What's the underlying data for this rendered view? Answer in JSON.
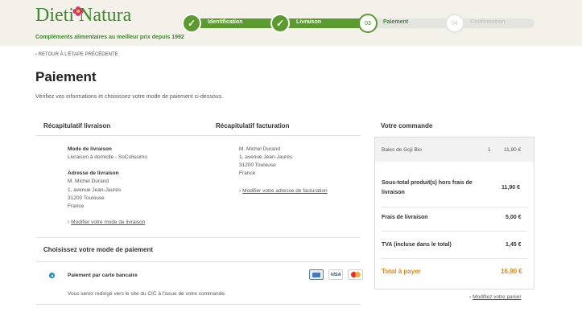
{
  "header": {
    "brand_part1": "Dieti",
    "brand_part2": "Natura",
    "tagline": "Compléments alimentaires au meilleur prix depuis 1992",
    "steps": [
      {
        "number": "✓",
        "label": "Identification",
        "state": "done"
      },
      {
        "number": "✓",
        "label": "Livraison",
        "state": "done"
      },
      {
        "number": "03",
        "label": "Paiement",
        "state": "current"
      },
      {
        "number": "04",
        "label": "Confirmation",
        "state": "todo"
      }
    ]
  },
  "back_link": "RETOUR À L'ÉTAPE PRÉCÉDENTE",
  "page_title": "Paiement",
  "intro": "Vérifiez vos informations et choisissez votre mode de paiement ci-dessous.",
  "delivery": {
    "title": "Récapitulatif livraison",
    "mode_label": "Mode de livraison",
    "mode_value": "Livraison à domicile - SoColissimo",
    "address_label": "Adresse de livraison",
    "address_lines": [
      "M. Michel Durand",
      "1, avenue Jean-Jaurès",
      "31200 Toulouse",
      "France"
    ],
    "modify_link": "Modifier votre mode de livraison"
  },
  "billing": {
    "title": "Récapitulatif facturation",
    "address_lines": [
      "M. Michel Durand",
      "1, avenue Jean-Jaurès",
      "31200 Toulouse",
      "France"
    ],
    "modify_link": "Modifier votre adresse de facturation"
  },
  "payment": {
    "title": "Choisissez votre mode de paiement",
    "option_label": "Paiement par carte bancaire",
    "option_note": "Vous serez redirigé vers le site du CIC à l'issue de votre commande.",
    "cards": [
      "CB",
      "VISA",
      "MasterCard"
    ],
    "selected": true
  },
  "order": {
    "title": "Votre commande",
    "item": {
      "name": "Baies de Goji Bio",
      "qty": "1",
      "price": "11,90 €"
    },
    "subtotal_label_1": "Sous-total produit(s) hors frais de",
    "subtotal_label_2": "livraison",
    "subtotal_value": "11,90 €",
    "shipping_label": "Frais de livraison",
    "shipping_value": "5,00 €",
    "tva_label": "TVA (incluse dans le total)",
    "tva_value": "1,45 €",
    "total_label": "Total à payer",
    "total_value": "16,90 €",
    "modify_cart": "Modifiez votre panier"
  },
  "colors": {
    "brand_green": "#3e8a2c",
    "progress_green": "#5b9a2e",
    "total_orange": "#e8851b",
    "radio_blue": "#2a9ad6"
  }
}
